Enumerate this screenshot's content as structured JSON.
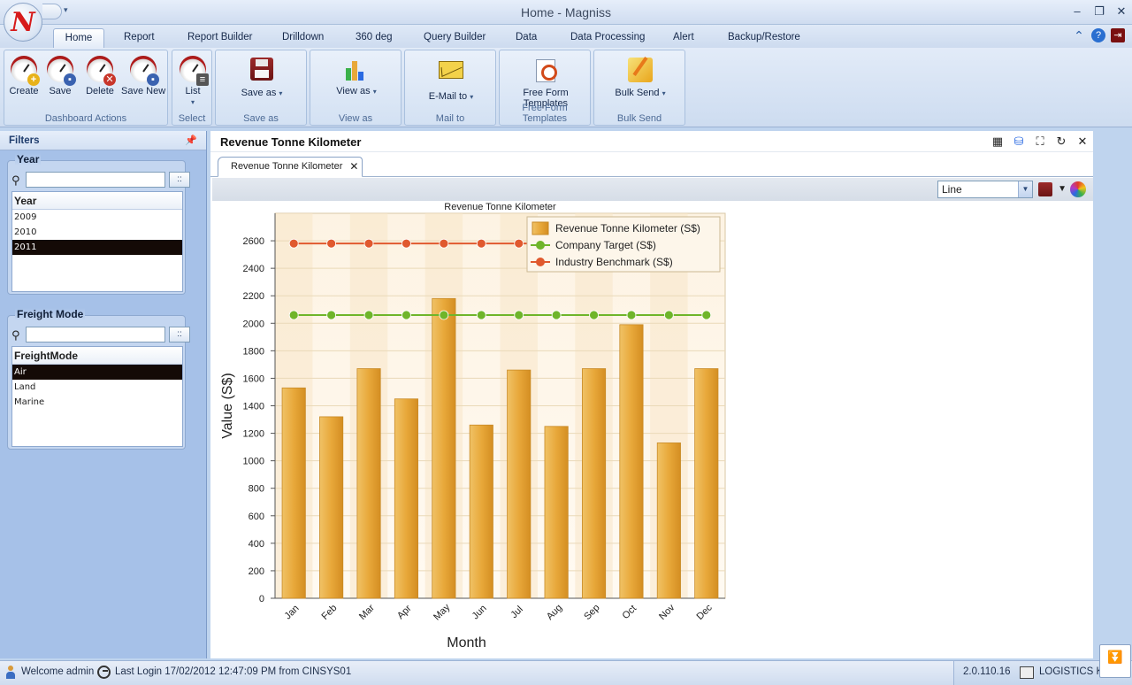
{
  "window": {
    "title": "Home - Magniss",
    "logo_letter": "N"
  },
  "menu": {
    "tabs": [
      "Home",
      "Report",
      "Report Builder",
      "Drilldown",
      "360 deg",
      "Query Builder",
      "Data",
      "Data Processing",
      "Alert",
      "Backup/Restore"
    ],
    "active": "Home"
  },
  "ribbon": {
    "dashboard_actions": {
      "label": "Dashboard Actions",
      "create": "Create",
      "save": "Save",
      "delete": "Delete",
      "save_new": "Save New"
    },
    "select": {
      "label": "Select",
      "list": "List"
    },
    "save_as": {
      "label": "Save as",
      "button": "Save as"
    },
    "view_as": {
      "label": "View as",
      "button": "View as"
    },
    "mail_to": {
      "label": "Mail to",
      "button": "E-Mail to"
    },
    "free_form": {
      "label": "Free Form Templates",
      "button_line1": "Free Form",
      "button_line2": "Templates"
    },
    "bulk_send": {
      "label": "Bulk Send",
      "button": "Bulk Send"
    }
  },
  "filters": {
    "title": "Filters",
    "year": {
      "title": "Year",
      "search_value": "",
      "column": "Year",
      "items": [
        "2009",
        "2010",
        "2011"
      ],
      "selected": "2011"
    },
    "freight": {
      "title": "Freight Mode",
      "search_value": "",
      "column": "FreightMode",
      "items": [
        "Air",
        "Land",
        "Marine"
      ],
      "selected": "Air"
    }
  },
  "main": {
    "title": "Revenue Tonne Kilometer",
    "tab": "Revenue Tonne Kilometer",
    "chart_type_selected": "Line"
  },
  "chart_data": {
    "type": "bar",
    "title": "Revenue Tonne Kilometer",
    "xlabel": "Month",
    "ylabel": "Value (S$)",
    "categories": [
      "Jan",
      "Feb",
      "Mar",
      "Apr",
      "May",
      "Jun",
      "Jul",
      "Aug",
      "Sep",
      "Oct",
      "Nov",
      "Dec"
    ],
    "ylim": [
      0,
      2800
    ],
    "yticks": [
      0,
      200,
      400,
      600,
      800,
      1000,
      1200,
      1400,
      1600,
      1800,
      2000,
      2200,
      2400,
      2600
    ],
    "legend_position": "top-right",
    "series": [
      {
        "name": "Revenue Tonne Kilometer (S$)",
        "kind": "bar",
        "color": "#e8a83a",
        "values": [
          1530,
          1320,
          1670,
          1450,
          2180,
          1260,
          1660,
          1250,
          1670,
          1990,
          1130,
          1670
        ]
      },
      {
        "name": "Company Target (S$)",
        "kind": "line",
        "color": "#6fb52a",
        "values": [
          2060,
          2060,
          2060,
          2060,
          2060,
          2060,
          2060,
          2060,
          2060,
          2060,
          2060,
          2060
        ]
      },
      {
        "name": "Industry Benchmark (S$)",
        "kind": "line",
        "color": "#e0592e",
        "values": [
          2580,
          2580,
          2580,
          2580,
          2580,
          2580,
          2580,
          2580,
          2580,
          2580,
          2580,
          2580
        ]
      }
    ]
  },
  "status": {
    "welcome": "Welcome admin",
    "last_login": "Last Login 17/02/2012 12:47:09 PM  from CINSYS01",
    "version": "2.0.110.16",
    "module": "LOGISTICS KP"
  }
}
